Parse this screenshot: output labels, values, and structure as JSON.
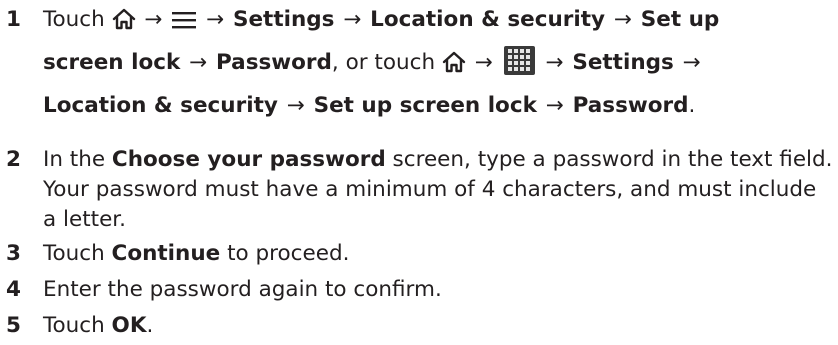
{
  "steps": [
    {
      "number": "1",
      "parts": {
        "touch1": "Touch",
        "settings1": "Settings",
        "locsec1": "Location & security",
        "setup1a": "Set up",
        "setup1b": "screen lock",
        "password1": "Password",
        "or_touch": ", or touch",
        "settings2": "Settings",
        "locsec2": "Location & security",
        "setup2": "Set up screen lock",
        "password2": "Password",
        "period": "."
      },
      "arrow": "→",
      "icons": [
        "home-icon",
        "menu-icon",
        "app-grid-icon"
      ]
    },
    {
      "number": "2",
      "pre": "In the ",
      "bold": "Choose your password",
      "post": " screen, type a password in the text field. Your password must have a minimum of 4 characters, and must include a letter."
    },
    {
      "number": "3",
      "pre": "Touch ",
      "bold": "Continue",
      "post": " to proceed."
    },
    {
      "number": "4",
      "text": "Enter the password again to confirm."
    },
    {
      "number": "5",
      "pre": "Touch ",
      "bold": "OK",
      "post": "."
    }
  ]
}
